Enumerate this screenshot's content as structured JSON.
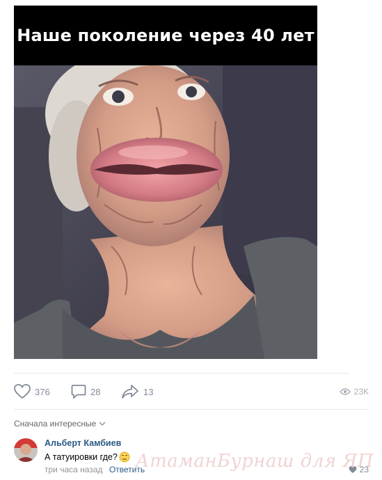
{
  "post": {
    "caption": "Наше поколение через 40 лет"
  },
  "actions": {
    "likes": "376",
    "comments": "28",
    "shares": "13",
    "views": "23K"
  },
  "comments_section": {
    "sort_label": "Сначала интересные"
  },
  "comment": {
    "author": "Альберт Камбиев",
    "text": "А татуировки где?",
    "time": "три часа назад",
    "reply_label": "Ответить",
    "likes": "23"
  },
  "watermark": "АтаманБурнаш для ЯП",
  "colors": {
    "link": "#2a5885",
    "icon": "#828a99",
    "divider": "#e7e8ec"
  },
  "icons": [
    "heart-icon",
    "comment-icon",
    "share-icon",
    "eye-icon",
    "chevron-down-icon",
    "emoji-icon"
  ]
}
